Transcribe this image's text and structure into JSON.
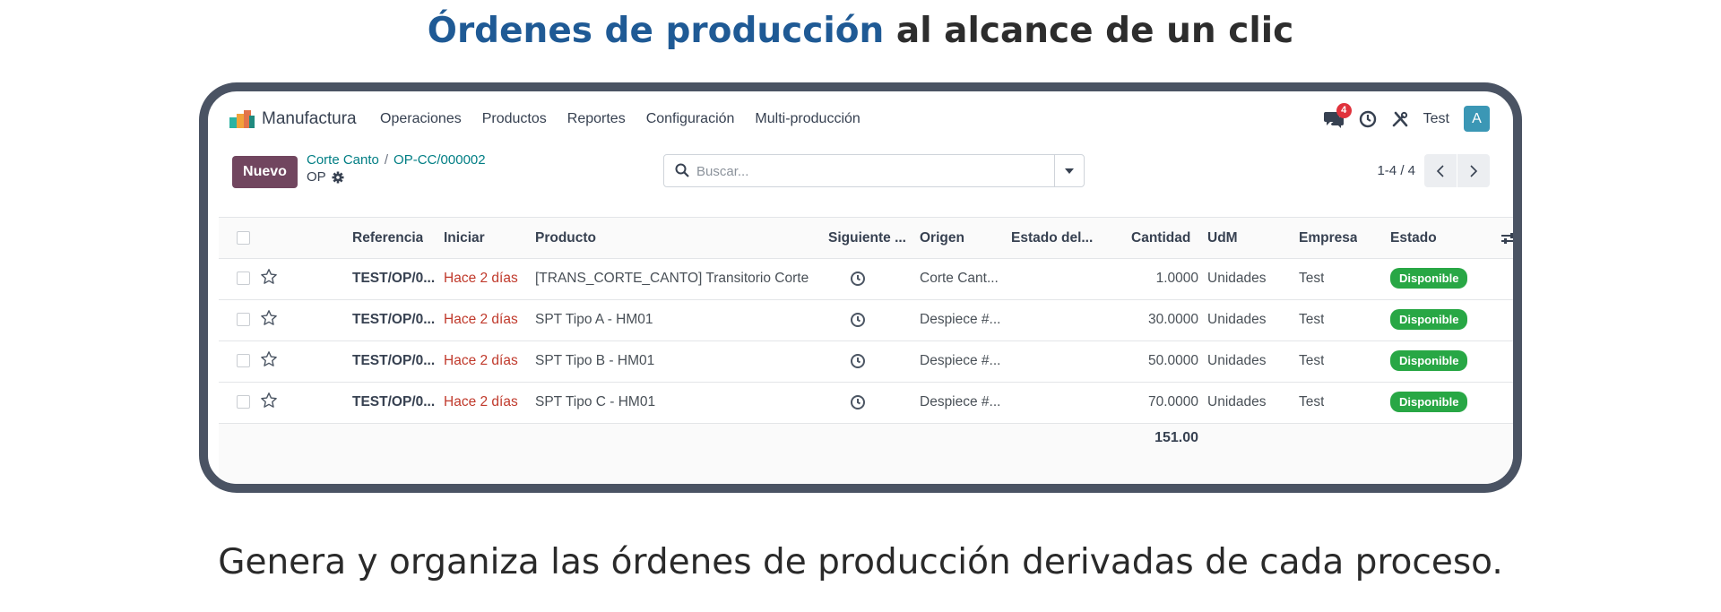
{
  "headline": {
    "accent": "Órdenes de producción",
    "rest": " al alcance de un clic"
  },
  "tagline": "Genera y organiza las órdenes de producción derivadas de cada proceso.",
  "app": {
    "name": "Manufactura"
  },
  "menu": [
    "Operaciones",
    "Productos",
    "Reportes",
    "Configuración",
    "Multi-producción"
  ],
  "systray": {
    "messages_count": "4",
    "user": "Test",
    "avatar_initial": "A"
  },
  "control_panel": {
    "new_button": "Nuevo",
    "breadcrumb": [
      "Corte Canto",
      "OP-CC/000002"
    ],
    "breadcrumb_sep": "/",
    "sub_title": "OP",
    "search_placeholder": "Buscar...",
    "pager": "1-4 / 4"
  },
  "table": {
    "headers": [
      "Referencia",
      "Iniciar",
      "Producto",
      "Siguiente ...",
      "Origen",
      "Estado del...",
      "Cantidad",
      "UdM",
      "Empresa",
      "Estado"
    ],
    "rows": [
      {
        "ref": "TEST/OP/0...",
        "start": "Hace 2 días",
        "product": "[TRANS_CORTE_CANTO] Transitorio Corte ...",
        "origin": "Corte Cant...",
        "qty": "1.0000",
        "uom": "Unidades",
        "company": "Test",
        "status": "Disponible"
      },
      {
        "ref": "TEST/OP/0...",
        "start": "Hace 2 días",
        "product": "SPT Tipo A - HM01",
        "origin": "Despiece #...",
        "qty": "30.0000",
        "uom": "Unidades",
        "company": "Test",
        "status": "Disponible"
      },
      {
        "ref": "TEST/OP/0...",
        "start": "Hace 2 días",
        "product": "SPT Tipo B - HM01",
        "origin": "Despiece #...",
        "qty": "50.0000",
        "uom": "Unidades",
        "company": "Test",
        "status": "Disponible"
      },
      {
        "ref": "TEST/OP/0...",
        "start": "Hace 2 días",
        "product": "SPT Tipo C - HM01",
        "origin": "Despiece #...",
        "qty": "70.0000",
        "uom": "Unidades",
        "company": "Test",
        "status": "Disponible"
      }
    ],
    "total_qty": "151.00"
  },
  "colors": {
    "accent": "#1f5a95",
    "primary_button": "#71465f",
    "badge": "#28a745",
    "link": "#017e84",
    "late": "#c0392b"
  }
}
